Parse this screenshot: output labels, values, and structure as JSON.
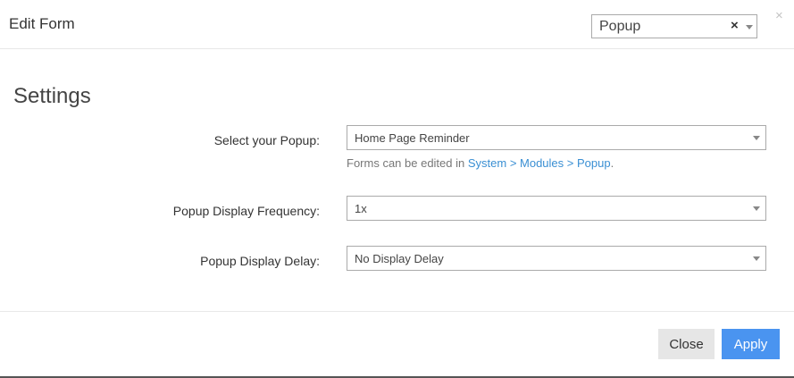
{
  "header": {
    "title": "Edit Form",
    "type_select": {
      "value": "Popup",
      "clear_glyph": "×"
    },
    "close_glyph": "×"
  },
  "settings": {
    "title": "Settings",
    "popup": {
      "label": "Select your Popup:",
      "value": "Home Page Reminder",
      "help_prefix": "Forms can be edited in ",
      "help_link": "System > Modules > Popup",
      "help_suffix": "."
    },
    "frequency": {
      "label": "Popup Display Frequency:",
      "value": "1x"
    },
    "delay": {
      "label": "Popup Display Delay:",
      "value": "No Display Delay"
    }
  },
  "footer": {
    "close_label": "Close",
    "apply_label": "Apply"
  },
  "colors": {
    "apply_button": "#4a94f0",
    "link": "#3a8fd3",
    "close_button": "#e6e6e6"
  }
}
